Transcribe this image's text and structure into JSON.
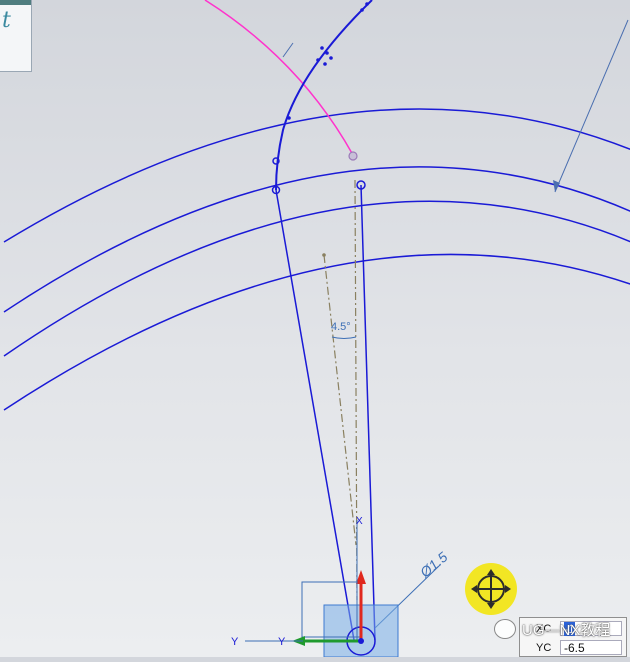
{
  "canvas": {
    "background_top": "#d3d6dc",
    "background_bottom": "#eceef0",
    "curve_color": "#1a1ad6",
    "arc_color": "#ff33cc",
    "centerline_color": "#8a8060"
  },
  "dimensions": {
    "angle_label": "4.5°",
    "diameter_label": "Ø1.5"
  },
  "triad": {
    "x_label": "X",
    "y_label": "Y",
    "y2_label": "Y",
    "x_color": "#e0281e",
    "y_color": "#1f9a2e"
  },
  "coordinate_input": {
    "xc_label": "XC",
    "xc_value": "-1",
    "yc_label": "YC",
    "yc_value": "-6.5"
  },
  "watermark": {
    "text": "UG—NX教程"
  },
  "icons": {
    "cursor": "move-cursor-icon",
    "panel": "dialog-glyph"
  }
}
